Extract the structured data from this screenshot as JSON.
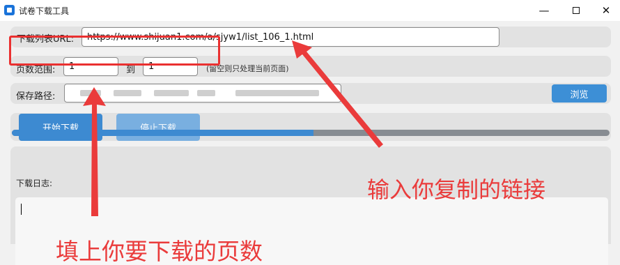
{
  "window": {
    "title": "试卷下载工具",
    "controls": {
      "minimize": "—",
      "close": "✕"
    }
  },
  "form": {
    "url_label": "下载列表URL:",
    "url_value": "https://www.shijuan1.com/a/sjyw1/list_106_1.html",
    "page_label": "页数范围:",
    "page_from": "1",
    "page_to_label": "到",
    "page_to": "1",
    "page_hint": "(留空则只处理当前页面)",
    "path_label": "保存路径:",
    "browse_button": "浏览"
  },
  "actions": {
    "start_button": "开始下载",
    "stop_button": "停止下载"
  },
  "progress": {
    "fraction": 0.505
  },
  "log": {
    "label": "下载日志:",
    "content": ""
  },
  "annotations": {
    "url_note": "输入你复制的链接",
    "page_note": "填上你要下载的页数",
    "color": "#ea3b3b"
  }
}
